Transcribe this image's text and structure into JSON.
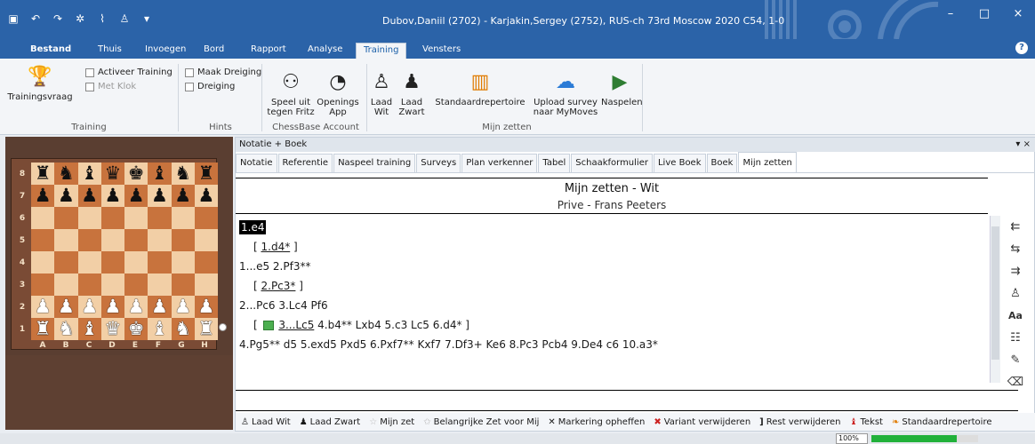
{
  "window": {
    "title": "Dubov,Daniil (2702) - Karjakin,Sergey (2752), RUS-ch 73rd Moscow 2020  C54, 1-0",
    "controls": [
      "–",
      "□",
      "×"
    ]
  },
  "ribbon_tabs": [
    "Bestand",
    "Thuis",
    "Invoegen",
    "Bord",
    "Rapport",
    "Analyse",
    "Training",
    "Vensters"
  ],
  "ribbon": {
    "training_group": {
      "label": "Training",
      "button_label": "Trainingsvraag",
      "checkbox_activeer": "Activeer Training",
      "checkbox_klok": "Met Klok"
    },
    "hints_group": {
      "label": "Hints",
      "checkbox_dreiging_maak": "Maak Dreiging",
      "checkbox_dreiging": "Dreiging"
    },
    "account_group": {
      "label": "ChessBase Account",
      "btn_fritz_1": "Speel uit",
      "btn_fritz_2": "tegen Fritz",
      "btn_openings_1": "Openings",
      "btn_openings_2": "App"
    },
    "mijn_group": {
      "label": "Mijn zetten",
      "btn_laad_wit_1": "Laad",
      "btn_laad_wit_2": "Wit",
      "btn_laad_zwart_1": "Laad",
      "btn_laad_zwart_2": "Zwart",
      "btn_standaard": "Standaardrepertoire",
      "btn_upload_1": "Upload survey",
      "btn_upload_2": "naar MyMoves",
      "btn_naspelen": "Naspelen"
    }
  },
  "board": {
    "ranks": [
      "8",
      "7",
      "6",
      "5",
      "4",
      "3",
      "2",
      "1"
    ],
    "files": [
      "A",
      "B",
      "C",
      "D",
      "E",
      "F",
      "G",
      "H"
    ]
  },
  "pane": {
    "title": "Notatie + Boek",
    "controls": "▾ ×",
    "tabs": [
      "Notatie",
      "Referentie",
      "Naspeel training",
      "Surveys",
      "Plan verkenner",
      "Tabel",
      "Schaakformulier",
      "Live Boek",
      "Boek",
      "Mijn zetten"
    ],
    "heading": "Mijn zetten - Wit",
    "subheading": "Prive - Frans Peeters"
  },
  "notation": {
    "l1": "1.e4",
    "l2_a": "1.d4*",
    "l3": "1...e5  2.Pf3**",
    "l4_a": "2.Pc3*",
    "l5": "2...Pc6  3.Lc4  Pf6",
    "l6_a": "3...Lc5",
    "l6_b": "4.b4**  Lxb4  5.c3  Lc5  6.d4*",
    "l7": "4.Pg5**  d5  5.exd5  Pxd5  6.Pxf7**  Kxf7  7.Df3+  Ke6  8.Pc3  Pcb4  9.De4  c6  10.a3*"
  },
  "bottom_toolbar": {
    "laad_wit": "Laad Wit",
    "laad_zwart": "Laad Zwart",
    "mijn_zet": "Mijn zet",
    "belangrijk": "Belangrijke Zet voor Mij",
    "markering": "Markering opheffen",
    "variant": "Variant verwijderen",
    "rest": "Rest verwijderen",
    "tekst": "Tekst",
    "standaard": "Standaardrepertoire"
  },
  "status": {
    "zoom": "100%",
    "progress": 0.8
  }
}
